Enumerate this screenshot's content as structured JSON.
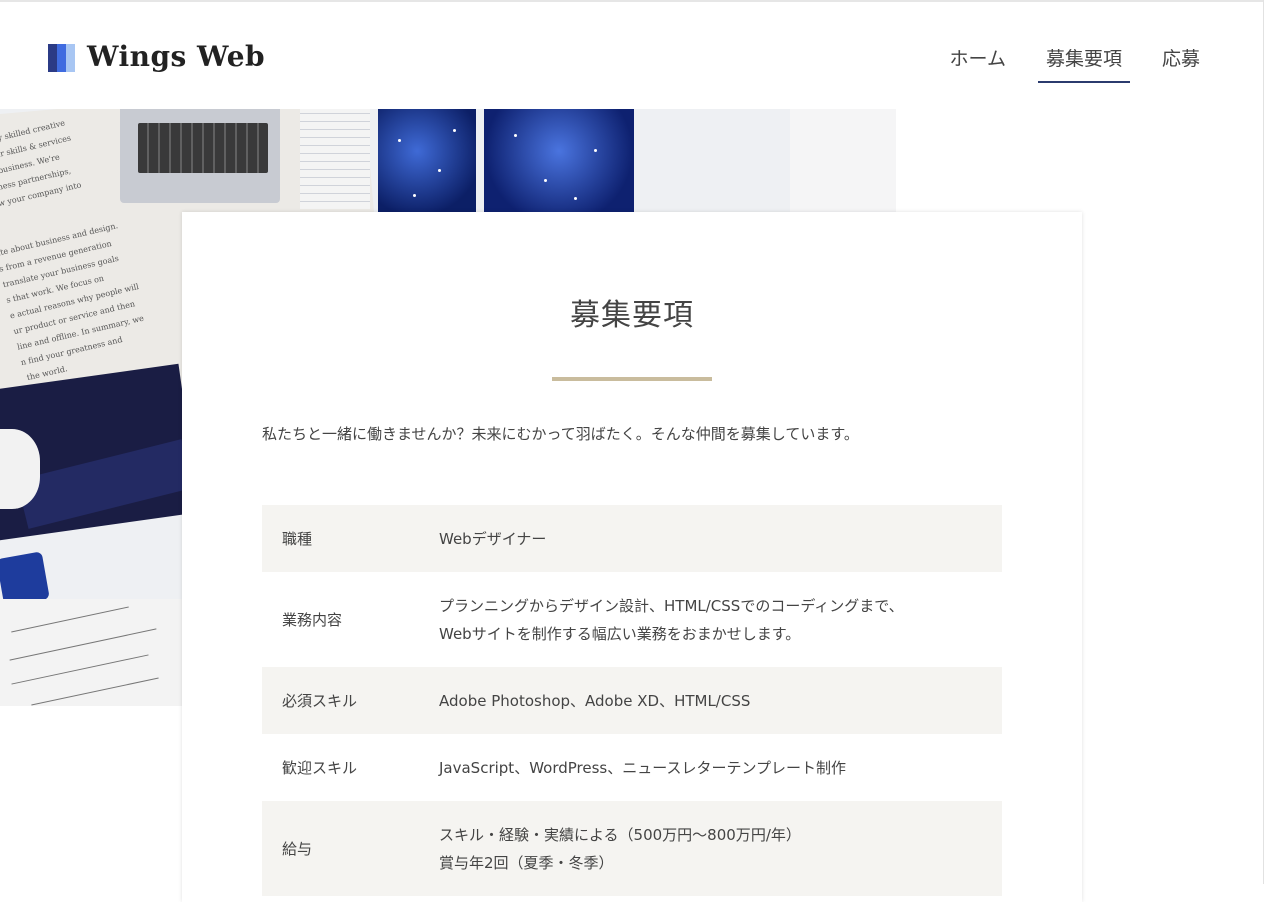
{
  "header": {
    "logo_text": "Wings Web",
    "nav": [
      {
        "label": "ホーム",
        "active": false
      },
      {
        "label": "募集要項",
        "active": true
      },
      {
        "label": "応募",
        "active": false
      }
    ]
  },
  "colors": {
    "accent": "#2b3b6e",
    "rule": "#c9bc9d",
    "row_shade": "#f5f4f1",
    "logo_blue_dark": "#2b3b86",
    "logo_blue_mid": "#3f6be0",
    "logo_blue_light": "#a8c6f3"
  },
  "card": {
    "title": "募集要項",
    "intro": "私たちと一緒に働きませんか？未来にむかって羽ばたく。そんな仲間を募集しています。",
    "rows": [
      {
        "key": "職種",
        "value_lines": [
          "Webデザイナー"
        ]
      },
      {
        "key": "業務内容",
        "value_lines": [
          "プランニングからデザイン設計、HTML/CSSでのコーディングまで、",
          "Webサイトを制作する幅広い業務をおまかせします。"
        ]
      },
      {
        "key": "必須スキル",
        "value_lines": [
          "Adobe Photoshop、Adobe XD、HTML/CSS"
        ]
      },
      {
        "key": "歓迎スキル",
        "value_lines": [
          "JavaScript、WordPress、ニュースレターテンプレート制作"
        ]
      },
      {
        "key": "給与",
        "value_lines": [
          "スキル・経験・実績による（500万円〜800万円/年）",
          "賞与年2回（夏季・冬季）"
        ]
      }
    ]
  }
}
